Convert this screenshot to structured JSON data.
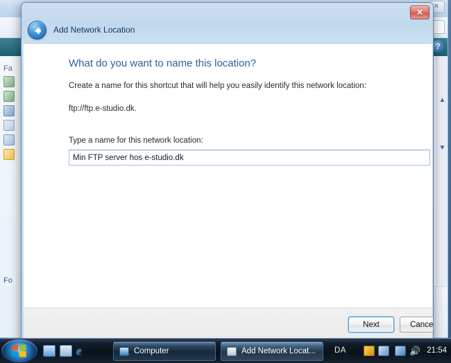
{
  "dialog": {
    "title": "Add Network Location",
    "back_icon": "back-arrow-icon",
    "close_label": "✕",
    "heading": "What do you want to name this location?",
    "instruction": "Create a name for this shortcut that will help you easily identify this network location:",
    "location_url": "ftp://ftp.e-studio.dk.",
    "field_label": "Type a name for this network location:",
    "name_value": "Min FTP server hos e-studio.dk",
    "name_placeholder": "",
    "next_label": "Next",
    "cancel_label": "Cancel",
    "accent_color": "#2c5f9e",
    "focus_color": "#3c93d4"
  },
  "background_window": {
    "sidebar_title": "Fa",
    "sidebar_title_lower": "Fo",
    "close_label": "✕",
    "search_icon": "search-icon",
    "help_icon": "help-icon",
    "scroll_up": "▲",
    "scroll_down": "▼"
  },
  "taskbar": {
    "start_label": "start-orb",
    "quick_launch": [
      {
        "name": "show-desktop",
        "label": ""
      },
      {
        "name": "switch-windows",
        "label": ""
      },
      {
        "name": "internet-explorer",
        "label": "e"
      }
    ],
    "buttons": [
      {
        "name": "computer",
        "label": "Computer"
      },
      {
        "name": "add-network-location",
        "label": "Add Network Locat..."
      }
    ],
    "language": "DA",
    "clock": "21:54",
    "volume_icon": "🔊"
  }
}
